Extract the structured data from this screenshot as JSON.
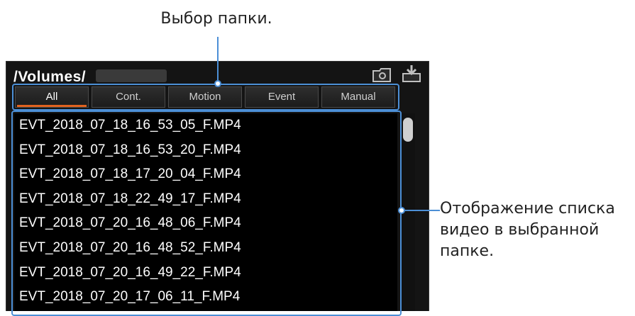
{
  "callouts": {
    "folder_select": "Выбор папки.",
    "video_list": "Отображение списка\nвидео в выбранной\nпапке."
  },
  "header": {
    "path": "/Volumes/"
  },
  "tabs": [
    {
      "label": "All",
      "active": true
    },
    {
      "label": "Cont.",
      "active": false
    },
    {
      "label": "Motion",
      "active": false
    },
    {
      "label": "Event",
      "active": false
    },
    {
      "label": "Manual",
      "active": false
    }
  ],
  "files": [
    "EVT_2018_07_18_16_53_05_F.MP4",
    "EVT_2018_07_18_16_53_20_F.MP4",
    "EVT_2018_07_18_17_20_04_F.MP4",
    "EVT_2018_07_18_22_49_17_F.MP4",
    "EVT_2018_07_20_16_48_06_F.MP4",
    "EVT_2018_07_20_16_48_52_F.MP4",
    "EVT_2018_07_20_16_49_22_F.MP4",
    "EVT_2018_07_20_17_06_11_F.MP4"
  ],
  "icons": {
    "folder": "folder-icon",
    "download": "download-icon"
  },
  "colors": {
    "highlight": "#4c8fd6",
    "tab_active_underline": "#e0621f",
    "list_background": "#000000"
  }
}
